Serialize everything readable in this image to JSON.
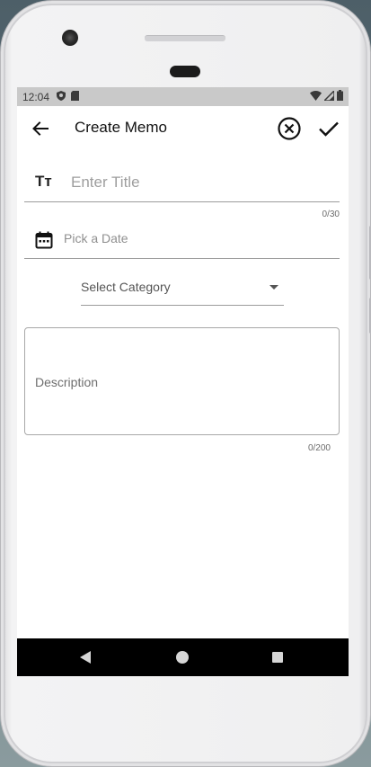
{
  "status_bar": {
    "time": "12:04",
    "left_icons": [
      "shield-icon",
      "sd-card-icon"
    ],
    "right_icons": [
      "wifi-icon",
      "signal-icon",
      "battery-icon"
    ]
  },
  "app_bar": {
    "back_icon": "arrow-back-icon",
    "title": "Create Memo",
    "cancel_icon": "close-circle-icon",
    "confirm_icon": "check-icon"
  },
  "form": {
    "title_field": {
      "icon": "text-size-icon",
      "placeholder": "Enter Title",
      "value": "",
      "counter": "0/30"
    },
    "date_field": {
      "icon": "calendar-icon",
      "placeholder": "Pick a Date",
      "value": ""
    },
    "category_select": {
      "label": "Select Category",
      "icon": "dropdown-arrow-icon"
    },
    "description_field": {
      "label": "Description",
      "value": "",
      "counter": "0/200"
    }
  },
  "nav_bar": {
    "icons": [
      "nav-back-icon",
      "nav-home-icon",
      "nav-recents-icon"
    ]
  },
  "colors": {
    "screen_bg": "#ffffff",
    "status_bar_bg": "#c9c9c9",
    "nav_bar_bg": "#000000",
    "placeholder": "#9e9e9e"
  }
}
